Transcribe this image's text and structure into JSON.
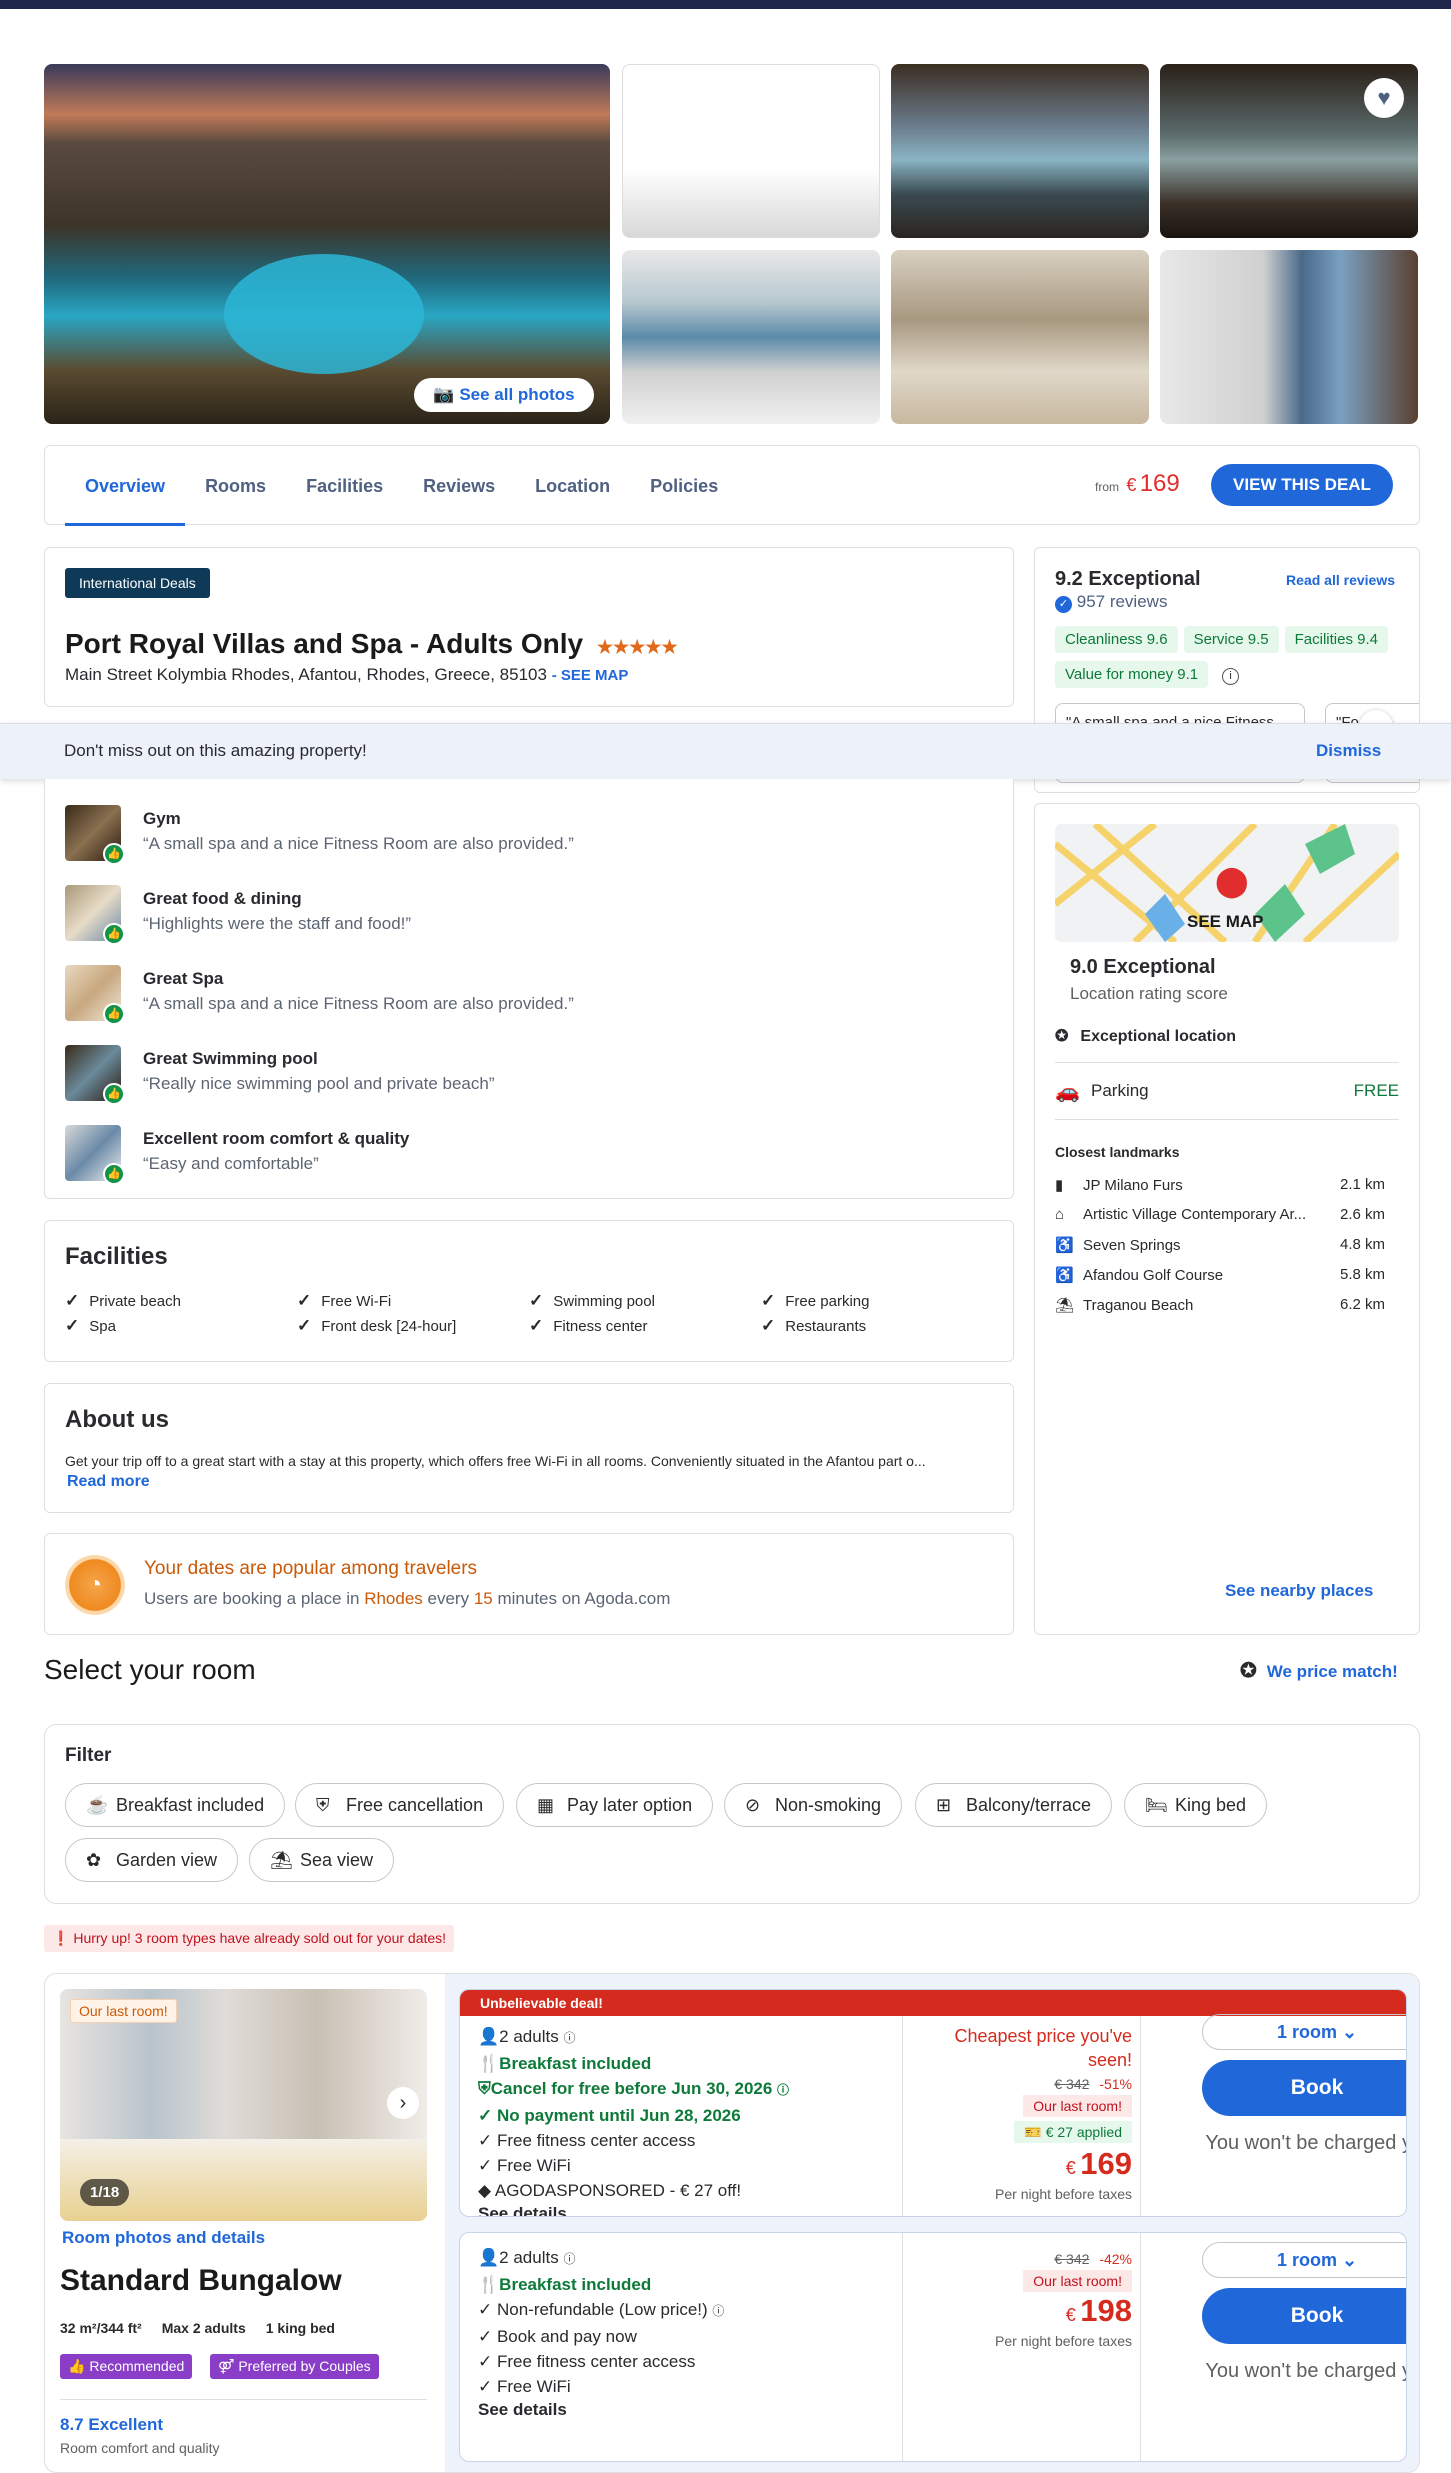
{
  "gallery": {
    "see_all": "See all photos"
  },
  "nav": {
    "tabs": [
      "Overview",
      "Rooms",
      "Facilities",
      "Reviews",
      "Location",
      "Policies"
    ],
    "from": "from",
    "currency": "€",
    "price": "169",
    "cta": "VIEW THIS DEAL"
  },
  "hotel": {
    "badge": "International Deals",
    "name": "Port Royal Villas and Spa - Adults Only",
    "stars": "★★★★★",
    "address": "Main Street Kolymbia Rhodes, Afantou, Rhodes, Greece, 85103",
    "see_map": "- SEE MAP"
  },
  "banner": {
    "text": "Don't miss out on this amazing property!",
    "dismiss": "Dismiss"
  },
  "highlights": [
    {
      "title": "Gym",
      "quote": "“A small spa and a nice Fitness Room are also provided.”"
    },
    {
      "title": "Great food & dining",
      "quote": "“Highlights were the staff and food!”"
    },
    {
      "title": "Great Spa",
      "quote": "“A small spa and a nice Fitness Room are also provided.”"
    },
    {
      "title": "Great Swimming pool",
      "quote": "“Really nice swimming pool and private beach”"
    },
    {
      "title": "Excellent room comfort & quality",
      "quote": "“Easy and comfortable”"
    }
  ],
  "reviews": {
    "score": "9.2 Exceptional",
    "read_all": "Read all reviews",
    "count": "957 reviews",
    "chips": [
      "Cleanliness 9.6",
      "Service 9.5",
      "Facilities 9.4",
      "Value for money 9.1"
    ],
    "snippet1": "\"A small spa and a nice Fitness",
    "snippet2": "\"Fo"
  },
  "facilities": {
    "title": "Facilities",
    "items": [
      "Private beach",
      "Free Wi-Fi",
      "Swimming pool",
      "Free parking",
      "Spa",
      "Front desk [24-hour]",
      "Fitness center",
      "Restaurants"
    ]
  },
  "about": {
    "title": "About us",
    "text": "Get your trip off to a great start with a stay at this property, which offers free Wi-Fi in all rooms. Conveniently situated in the Afantou part o...",
    "read_more": "Read more"
  },
  "popular": {
    "title": "Your dates are popular among travelers",
    "pre": "Users are booking a place in ",
    "city": "Rhodes",
    "mid": " every ",
    "minutes": "15",
    "post": " minutes on Agoda.com"
  },
  "location": {
    "see_map": "SEE MAP",
    "score": "9.0 Exceptional",
    "sub": "Location rating score",
    "exceptional": "Exceptional location",
    "parking": "Parking",
    "parking_val": "FREE",
    "landmarks_title": "Closest landmarks",
    "landmarks": [
      {
        "icon": "shopping-bag-icon",
        "name": "JP Milano Furs",
        "dist": "2.1 km"
      },
      {
        "icon": "museum-icon",
        "name": "Artistic Village Contemporary Ar...",
        "dist": "2.6 km"
      },
      {
        "icon": "accessible-icon",
        "name": "Seven Springs",
        "dist": "4.8 km"
      },
      {
        "icon": "accessible-icon",
        "name": "Afandou Golf Course",
        "dist": "5.8 km"
      },
      {
        "icon": "beach-icon",
        "name": "Traganou Beach",
        "dist": "6.2 km"
      }
    ],
    "nearby": "See nearby places"
  },
  "select": {
    "title": "Select your room",
    "price_match": "We price match!"
  },
  "filter": {
    "title": "Filter",
    "items": [
      {
        "icon": "coffee-icon",
        "label": "Breakfast included"
      },
      {
        "icon": "shield-icon",
        "label": "Free cancellation"
      },
      {
        "icon": "calendar-icon",
        "label": "Pay later option"
      },
      {
        "icon": "no-smoking-icon",
        "label": "Non-smoking"
      },
      {
        "icon": "balcony-icon",
        "label": "Balcony/terrace"
      },
      {
        "icon": "bed-icon",
        "label": "King bed"
      },
      {
        "icon": "flower-icon",
        "label": "Garden view"
      },
      {
        "icon": "beach-icon",
        "label": "Sea view"
      }
    ]
  },
  "hurry": "Hurry up! 3 room types have already sold out for your dates!",
  "room": {
    "last_room": "Our last room!",
    "counter": "1/18",
    "photos_link": "Room photos and details",
    "name": "Standard Bungalow",
    "size": "32 m²/344 ft²",
    "max": "Max 2 adults",
    "bed": "1 king bed",
    "tag1": "Recommended",
    "tag2": "Preferred by Couples",
    "rating": "8.7 Excellent",
    "rating_sub": "Room comfort and quality"
  },
  "offer1": {
    "ribbon": "Unbelievable deal!",
    "adults": "2 adults",
    "lines": [
      "Breakfast included",
      "Cancel for free before Jun 30, 2026",
      "No payment until Jun 28, 2026",
      "Free fitness center access",
      "Free WiFi",
      "AGODASPONSORED - € 27 off!"
    ],
    "details": "See details",
    "cheapest": "Cheapest price you've seen!",
    "old": "€ 342",
    "disc": "-51%",
    "last": "Our last room!",
    "applied": "€ 27 applied",
    "cur": "€",
    "price": "169",
    "per": "Per night before taxes",
    "rooms": "1 room",
    "book": "Book",
    "nocharge": "You won't be charged yet"
  },
  "offer2": {
    "adults": "2 adults",
    "lines": [
      "Breakfast included",
      "Non-refundable (Low price!)",
      "Book and pay now",
      "Free fitness center access",
      "Free WiFi"
    ],
    "details": "See details",
    "old": "€ 342",
    "disc": "-42%",
    "last": "Our last room!",
    "cur": "€",
    "price": "198",
    "per": "Per night before taxes",
    "rooms": "1 room",
    "book": "Book",
    "nocharge": "You won't be charged yet"
  },
  "colors": {
    "brand_blue": "#2067da",
    "price_red": "#e12d2d",
    "green": "#0e7a3a",
    "navy": "#20274d"
  }
}
